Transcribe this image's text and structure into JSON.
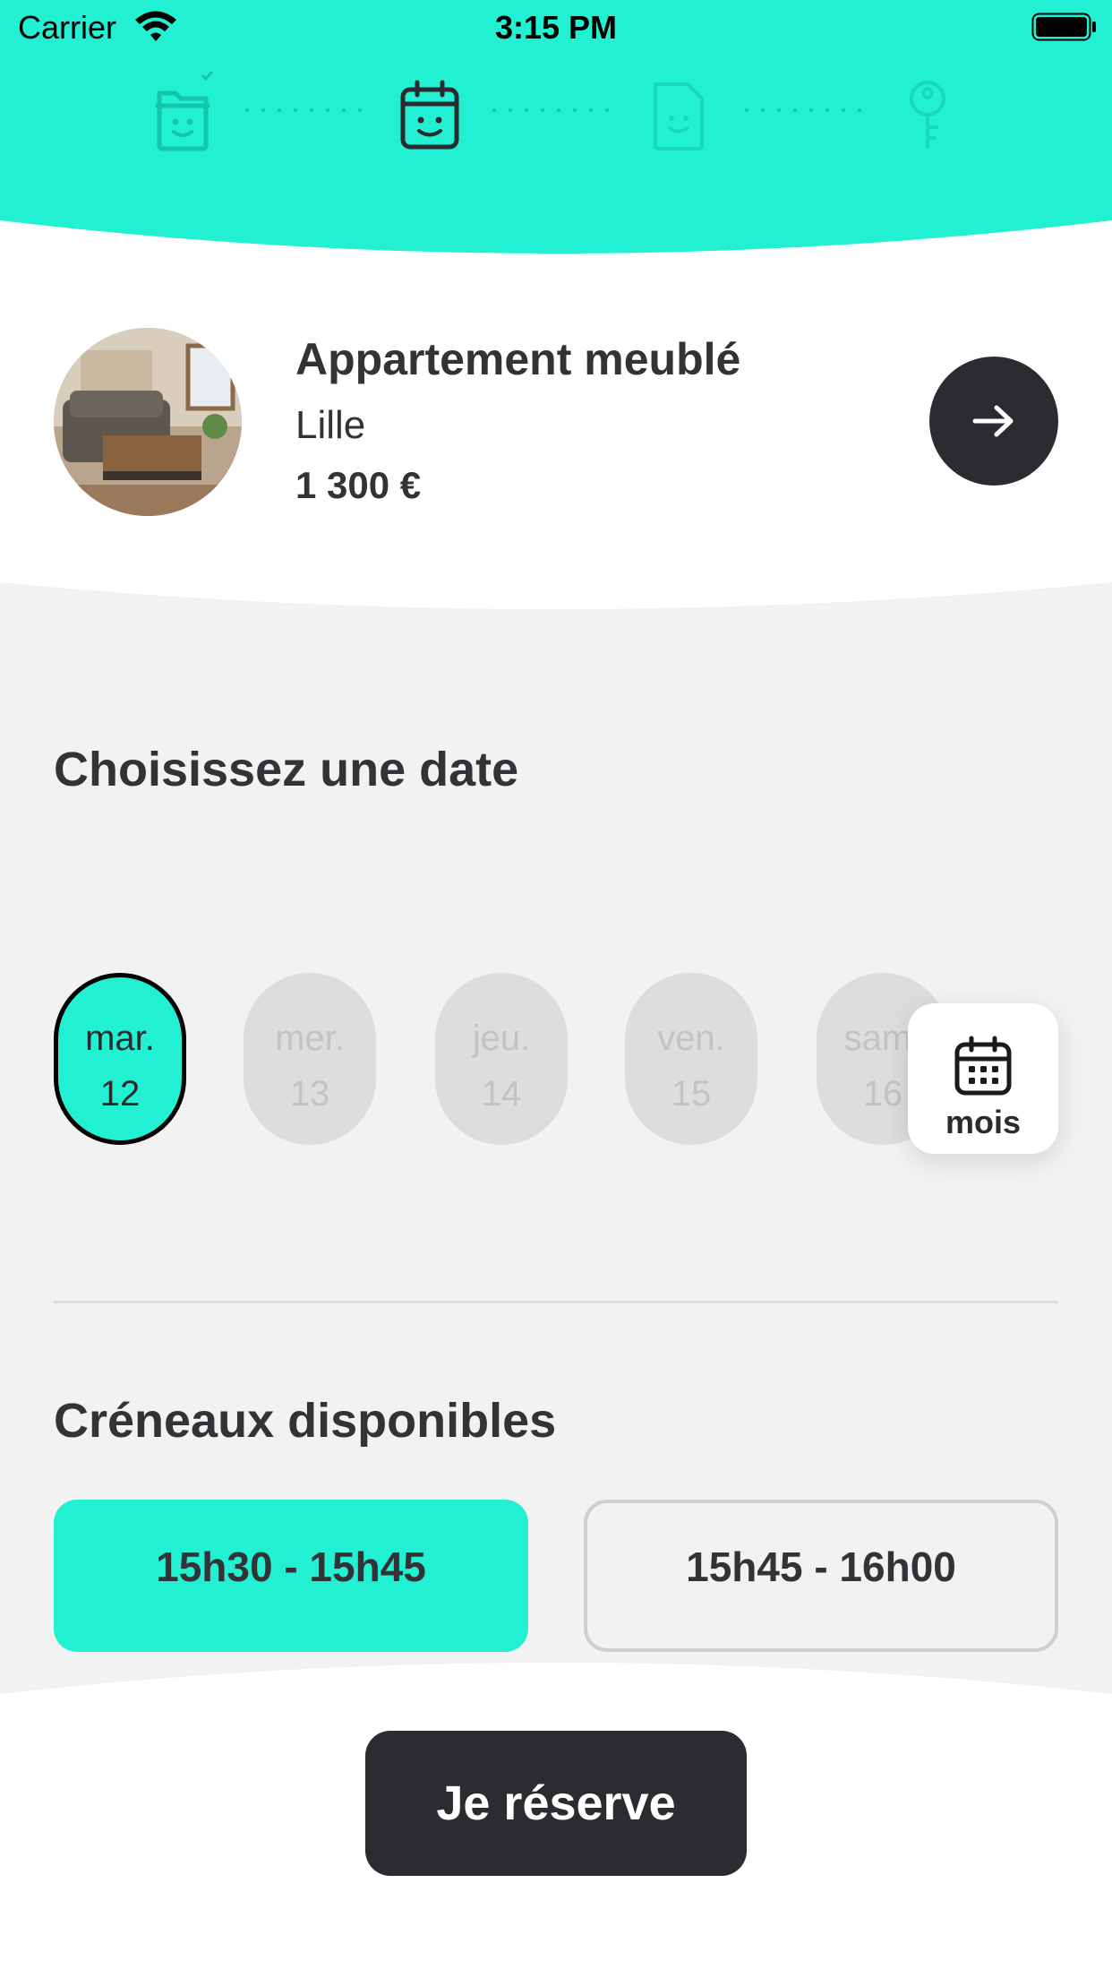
{
  "status_bar": {
    "carrier": "Carrier",
    "time": "3:15 PM"
  },
  "steps": [
    {
      "icon": "folder-smile-icon",
      "state": "done"
    },
    {
      "icon": "calendar-smile-icon",
      "state": "current"
    },
    {
      "icon": "document-smile-icon",
      "state": "upcoming"
    },
    {
      "icon": "key-icon",
      "state": "upcoming"
    }
  ],
  "property": {
    "title": "Appartement meublé",
    "city": "Lille",
    "price": "1 300 €"
  },
  "date_section": {
    "title": "Choisissez une date",
    "days": [
      {
        "weekday": "mar.",
        "day": "12",
        "selected": true
      },
      {
        "weekday": "mer.",
        "day": "13",
        "selected": false
      },
      {
        "weekday": "jeu.",
        "day": "14",
        "selected": false
      },
      {
        "weekday": "ven.",
        "day": "15",
        "selected": false
      },
      {
        "weekday": "sam.",
        "day": "16",
        "selected": false
      }
    ],
    "month_button_label": "mois"
  },
  "slots_section": {
    "title": "Créneaux disponibles",
    "slots": [
      {
        "label": "15h30 - 15h45",
        "selected": true
      },
      {
        "label": "15h45 - 16h00",
        "selected": false
      }
    ]
  },
  "reserve_button": "Je réserve",
  "colors": {
    "accent": "#21f0d2",
    "dark": "#2c2c30",
    "background": "#f2f2f2"
  }
}
